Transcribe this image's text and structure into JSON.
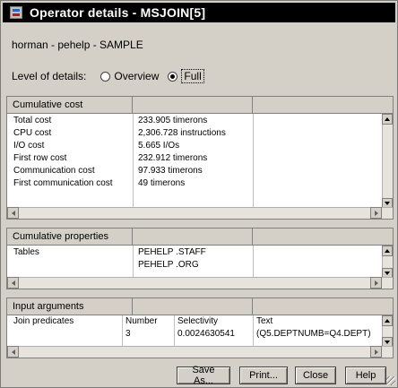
{
  "window": {
    "title": "Operator details - MSJOIN[5]",
    "context": "horman - pehelp - SAMPLE"
  },
  "level_of_details": {
    "label": "Level of details:",
    "options": [
      {
        "label": "Overview",
        "selected": false
      },
      {
        "label": "Full",
        "selected": true
      }
    ]
  },
  "cumulative_cost": {
    "header": "Cumulative cost",
    "rows": [
      {
        "name": "Total cost",
        "value": "233.905 timerons"
      },
      {
        "name": "CPU cost",
        "value": "2,306.728 instructions"
      },
      {
        "name": "I/O cost",
        "value": "5.665 I/Os"
      },
      {
        "name": "First row cost",
        "value": "232.912 timerons"
      },
      {
        "name": "Communication cost",
        "value": "97.933 timerons"
      },
      {
        "name": "First communication cost",
        "value": "49 timerons"
      }
    ]
  },
  "cumulative_properties": {
    "header": "Cumulative properties",
    "rows": [
      {
        "name": "Tables",
        "values": [
          "PEHELP .STAFF",
          "PEHELP .ORG"
        ]
      }
    ]
  },
  "input_arguments": {
    "header": "Input arguments",
    "row_label": "Join predicates",
    "columns": [
      "Number",
      "Selectivity",
      "Text"
    ],
    "rows": [
      {
        "number": "3",
        "selectivity": "0.0024630541",
        "text": "(Q5.DEPTNUMB=Q4.DEPT)"
      }
    ]
  },
  "buttons": {
    "save_as": "Save As...",
    "print": "Print...",
    "close": "Close",
    "help": "Help"
  },
  "colors": {
    "titlebar": "#000000",
    "dialog_bg": "#d4d0c8",
    "panel_bg": "#ffffff"
  }
}
